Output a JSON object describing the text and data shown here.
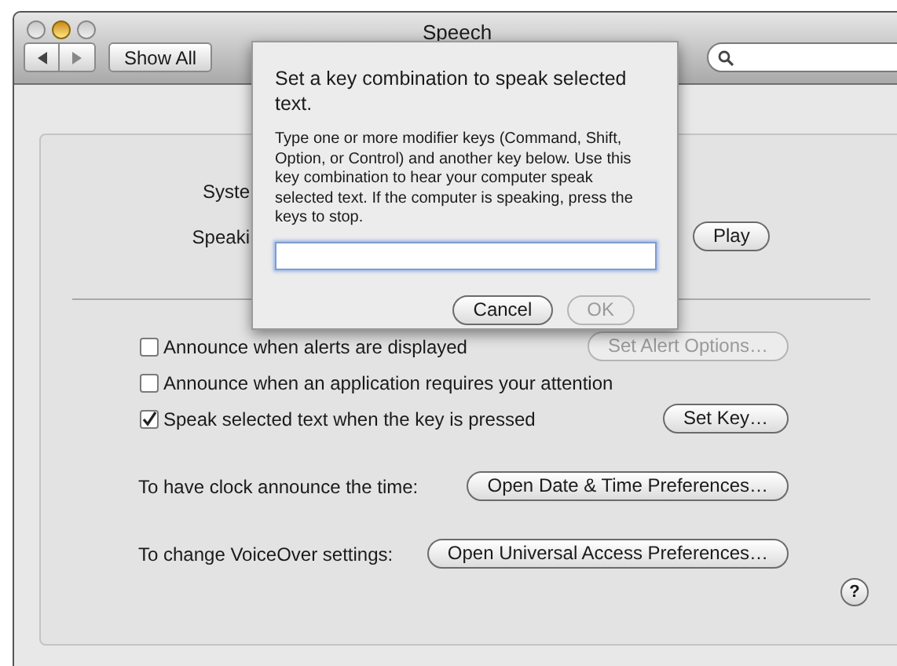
{
  "window": {
    "title": "Speech"
  },
  "toolbar": {
    "show_all": "Show All"
  },
  "background_rows": [
    {
      "label": "Syste"
    },
    {
      "label": "Speaki",
      "button": "Play"
    }
  ],
  "options": [
    {
      "label": "Announce when alerts are displayed",
      "checked": false,
      "button": {
        "label": "Set Alert Options…",
        "disabled": true
      }
    },
    {
      "label": "Announce when an application requires your attention",
      "checked": false
    },
    {
      "label": "Speak selected text when the key is pressed",
      "checked": true,
      "button": {
        "label": "Set Key…",
        "disabled": false
      }
    }
  ],
  "links": [
    {
      "label": "To have clock announce the time:",
      "button": "Open Date & Time Preferences…"
    },
    {
      "label": "To change VoiceOver settings:",
      "button": "Open Universal Access Preferences…"
    }
  ],
  "help": "?",
  "sheet": {
    "title": "Set a key combination to speak selected text.",
    "message": "Type one or more modifier keys (Command, Shift, Option, or Control) and another key below. Use this key combination to hear your computer speak selected text. If the computer is speaking, press the keys to stop.",
    "buttons": [
      {
        "label": "Cancel",
        "disabled": false
      },
      {
        "label": "OK",
        "disabled": true
      }
    ]
  }
}
